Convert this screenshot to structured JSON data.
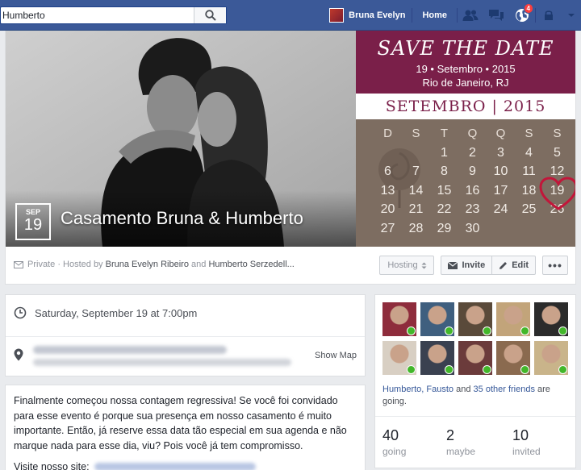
{
  "search": {
    "value": "Humberto"
  },
  "nav": {
    "user_name": "Bruna Evelyn",
    "home_label": "Home",
    "notification_count": "4"
  },
  "event": {
    "month": "SEP",
    "day": "19",
    "title": "Casamento Bruna & Humberto",
    "privacy": "Private",
    "hosted_by": "· Hosted by",
    "host1": "Bruna Evelyn Ribeiro",
    "and": "and",
    "host2": "Humberto Serzedell...",
    "when": "Saturday, September 19 at 7:00pm",
    "show_map": "Show Map",
    "description": "Finalmente começou nossa contagem regressiva! Se você foi convidado para esse evento é porque sua presença em nosso casamento é muito importante. Então, já reserve essa data tão especial em sua agenda e não marque nada para esse dia, viu? Pois você já tem compromisso.",
    "visit_label": "Visite nosso site:"
  },
  "calendar_image": {
    "save_the_date": "SAVE THE DATE",
    "date_line": "19 • Setembro • 2015",
    "city": "Rio de Janeiro, RJ",
    "month_title": "SETEMBRO | 2015",
    "weekdays": [
      "D",
      "S",
      "T",
      "Q",
      "Q",
      "S",
      "S"
    ],
    "weeks": [
      [
        "",
        "",
        "1",
        "2",
        "3",
        "4",
        "5"
      ],
      [
        "6",
        "7",
        "8",
        "9",
        "10",
        "11",
        "12"
      ],
      [
        "13",
        "14",
        "15",
        "16",
        "17",
        "18",
        "19"
      ],
      [
        "20",
        "21",
        "22",
        "23",
        "24",
        "25",
        "26"
      ],
      [
        "27",
        "28",
        "29",
        "30",
        "",
        "",
        ""
      ]
    ]
  },
  "actions": {
    "hosting_label": "Hosting",
    "invite_label": "Invite",
    "edit_label": "Edit"
  },
  "guests": {
    "friends_prefix": "Humberto, Fausto",
    "friends_and": "and",
    "others_link": "35 other friends",
    "friends_suffix": "are going.",
    "going_count": "40",
    "going_label": "going",
    "maybe_count": "2",
    "maybe_label": "maybe",
    "invited_count": "10",
    "invited_label": "invited",
    "face_colors": [
      "#8e2c3c",
      "#3f5f7f",
      "#5a4a3a",
      "#c2a47a",
      "#2b2b2b",
      "#d8cfc3",
      "#3a4150",
      "#6b3b3b",
      "#8a6a4f",
      "#c9b48a"
    ]
  }
}
